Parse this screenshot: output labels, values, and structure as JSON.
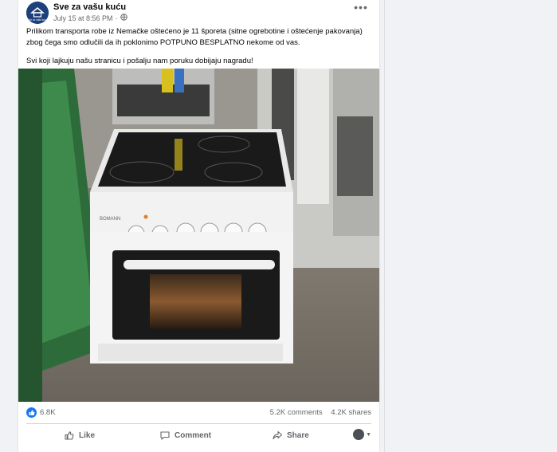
{
  "post": {
    "page_name": "Sve za vašu kuću",
    "timestamp": "July 15 at 8:56 PM",
    "privacy_icon": "globe-icon",
    "more_icon": "more-options-icon",
    "text_p1": "Prilikom transporta robe iz Nemačke oštećeno je 11 šporeta (sitne ogrebotine i oštećenje pakovanja) zbog čega smo odlučili da ih poklonimo POTPUNO BESPLATNO nekome od vas.",
    "text_p2": "Svi koji lajkuju našu stranicu i pošalju nam poruku dobijaju nagradu!",
    "photo_brand_text": "BOMANN",
    "avatar_text": "Sve za vašu kuću"
  },
  "stats": {
    "likes": "6.8K",
    "comments": "5.2K comments",
    "shares": "4.2K shares"
  },
  "actions": {
    "like": "Like",
    "comment": "Comment",
    "share": "Share"
  },
  "colors": {
    "accent": "#1877f2",
    "secondary_text": "#65676b",
    "background": "#f0f2f5"
  }
}
